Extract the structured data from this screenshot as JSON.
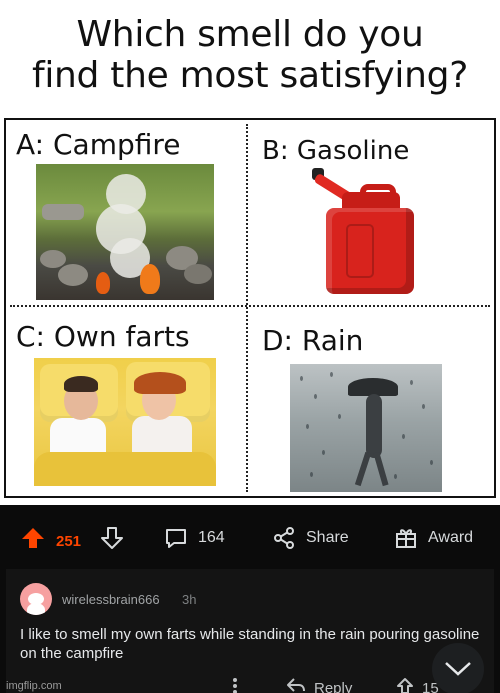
{
  "meme": {
    "question_line1": "Which smell do you",
    "question_line2": "find the most satisfying?",
    "options": [
      {
        "label": "A: Campfire"
      },
      {
        "label": "B: Gasoline"
      },
      {
        "label": "C: Own farts"
      },
      {
        "label": "D: Rain"
      }
    ]
  },
  "post_actions": {
    "upvote_icon": "upvote-arrow-icon",
    "score": "251",
    "downvote_icon": "downvote-arrow-icon",
    "comments_icon": "comment-bubble-icon",
    "comments_count": "164",
    "share_icon": "share-icon",
    "share_label": "Share",
    "award_icon": "award-gift-icon",
    "award_label": "Award",
    "accent_color": "#ff4500"
  },
  "comment": {
    "username": "wirelessbrain666",
    "age": "3h",
    "text": "I like to smell my own farts while standing in the rain pouring gasoline on the campfire",
    "reply_label": "Reply",
    "vote_count": "15",
    "more_icon": "more-dots-icon",
    "collapse_icon": "chevron-down-icon"
  },
  "watermark": "imgflip.com"
}
